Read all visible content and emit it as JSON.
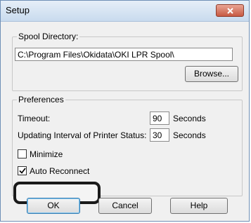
{
  "window": {
    "title": "Setup"
  },
  "spool": {
    "group_label": "Spool Directory:",
    "path": "C:\\Program Files\\Okidata\\OKI LPR Spool\\",
    "browse_label": "Browse..."
  },
  "preferences": {
    "group_label": "Preferences",
    "timeout_label": "Timeout:",
    "timeout_value": "90",
    "timeout_unit": "Seconds",
    "interval_label": "Updating Interval of Printer Status:",
    "interval_value": "30",
    "interval_unit": "Seconds",
    "minimize_label": "Minimize",
    "minimize_checked": false,
    "auto_reconnect_label": "Auto Reconnect",
    "auto_reconnect_checked": true
  },
  "buttons": {
    "ok": "OK",
    "cancel": "Cancel",
    "help": "Help"
  },
  "colors": {
    "callout_border": "#1a1a1a",
    "close_button": "#c75a43"
  }
}
